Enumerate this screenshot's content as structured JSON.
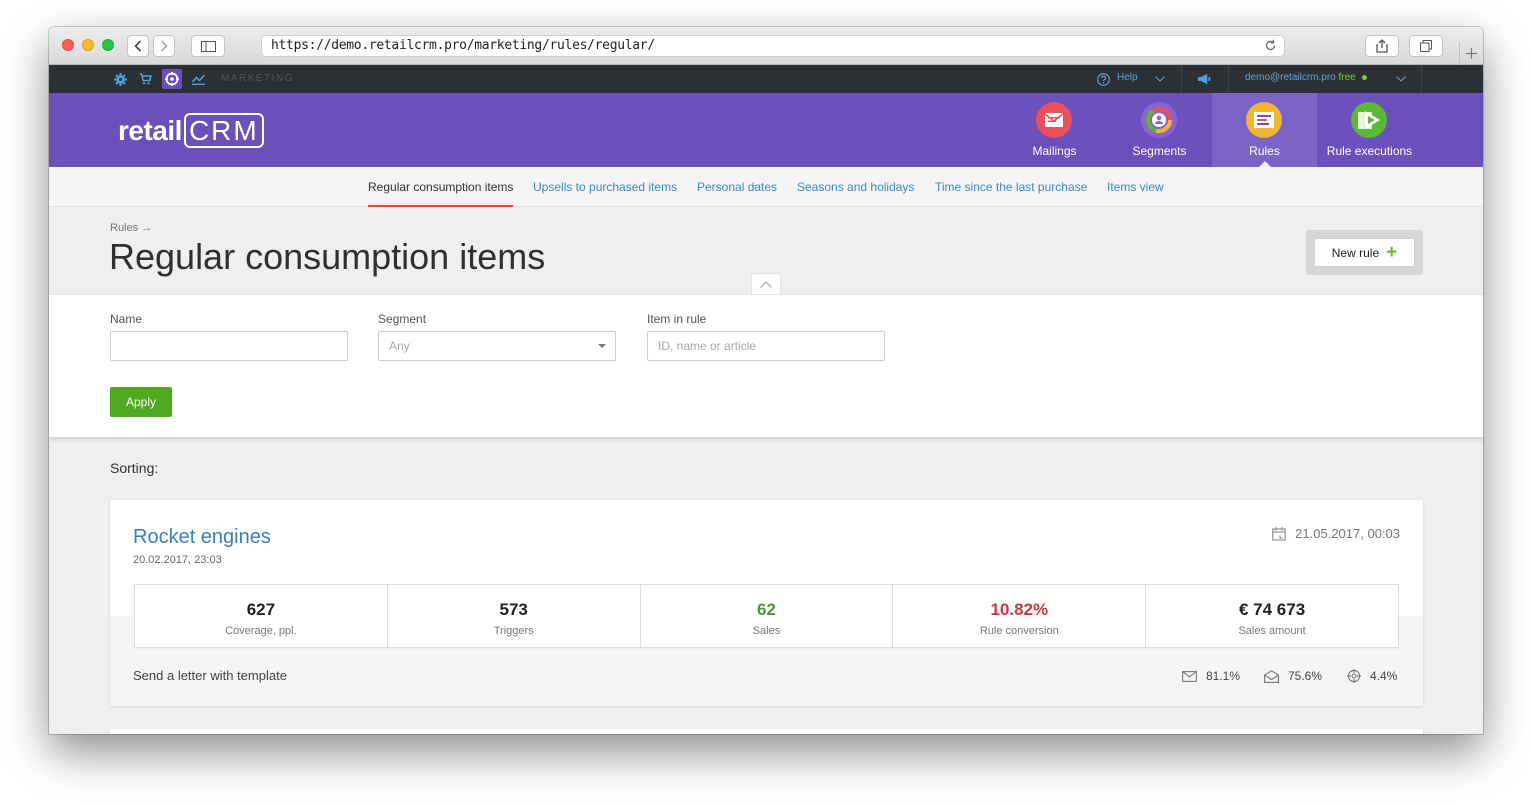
{
  "browser": {
    "url": "https://demo.retailcrm.pro/marketing/rules/regular/"
  },
  "topbar": {
    "section": "MARKETING",
    "help": "Help",
    "user_email": "demo@retailcrm.pro",
    "plan": "free"
  },
  "header": {
    "logo_text": "retail",
    "logo_crm": "CRM",
    "nav": [
      {
        "label": "Mailings",
        "icon": "mailings-icon",
        "color": "#e8505b"
      },
      {
        "label": "Segments",
        "icon": "segments-icon",
        "color": "#8a63d2"
      },
      {
        "label": "Rules",
        "icon": "rules-icon",
        "color": "#f2b630",
        "active": true
      },
      {
        "label": "Rule executions",
        "icon": "rule-executions-icon",
        "color": "#5cb934"
      }
    ]
  },
  "subnav": {
    "tabs": [
      {
        "label": "Regular consumption items",
        "active": true
      },
      {
        "label": "Upsells to purchased items"
      },
      {
        "label": "Personal dates"
      },
      {
        "label": "Seasons and holidays"
      },
      {
        "label": "Time since the last purchase"
      },
      {
        "label": "Items view"
      }
    ]
  },
  "page": {
    "breadcrumb": "Rules →",
    "title": "Regular consumption items",
    "new_rule_label": "New rule"
  },
  "filters": {
    "name_label": "Name",
    "name_value": "",
    "segment_label": "Segment",
    "segment_value": "Any",
    "item_label": "Item in rule",
    "item_placeholder": "ID, name or article",
    "apply_label": "Apply"
  },
  "sorting_label": "Sorting:",
  "rule": {
    "title": "Rocket engines",
    "created": "20.02.2017, 23:03",
    "updated": "21.05.2017, 00:03",
    "stats": [
      {
        "value": "627",
        "label": "Coverage, ppl."
      },
      {
        "value": "573",
        "label": "Triggers"
      },
      {
        "value": "62",
        "label": "Sales",
        "color": "#4a9a3a"
      },
      {
        "value": "10.82%",
        "label": "Rule conversion",
        "color": "#c93a3a"
      },
      {
        "value": "€ 74 673",
        "label": "Sales amount"
      }
    ],
    "action": "Send a letter with template",
    "metrics": {
      "delivered": "81.1%",
      "opened": "75.6%",
      "clicked": "4.4%"
    }
  }
}
